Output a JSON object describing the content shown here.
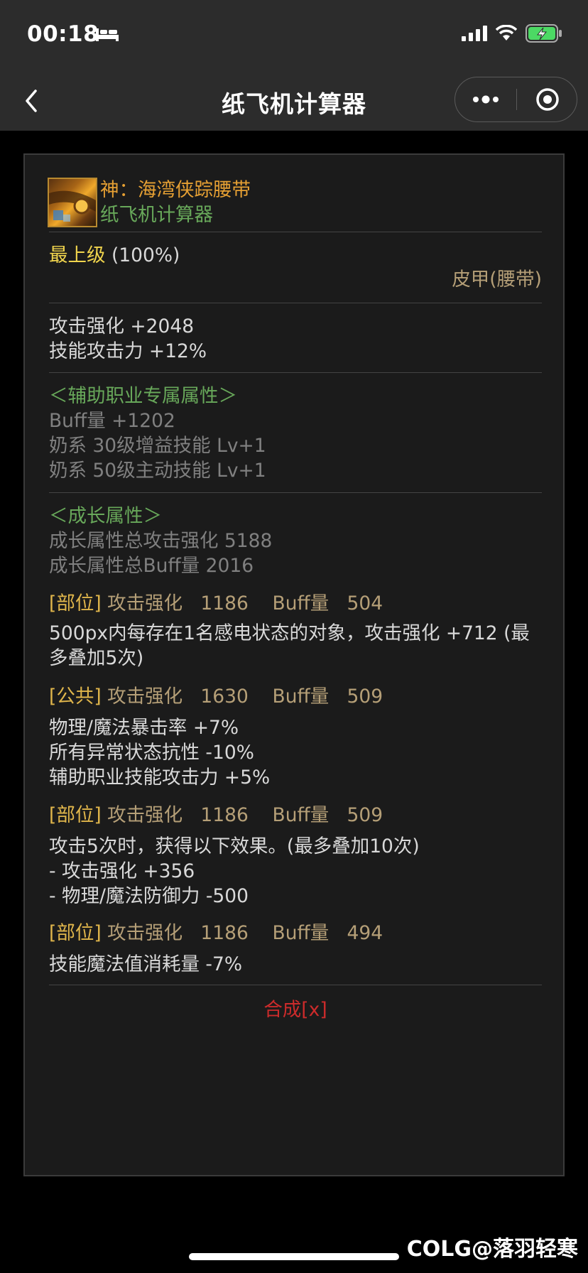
{
  "status": {
    "time": "00:18"
  },
  "nav": {
    "title": "纸飞机计算器"
  },
  "item": {
    "name": "神：海湾侠踪腰带",
    "source": "纸飞机计算器",
    "grade_label": "最上级",
    "grade_value": "(100%)",
    "type": "皮甲(腰带)",
    "base_stats": [
      "攻击强化 +2048",
      "技能攻击力 +12%"
    ],
    "support_title": "＜辅助职业专属属性＞",
    "support_stats": [
      "Buff量 +1202",
      "奶系 30级增益技能 Lv+1",
      "奶系 50级主动技能 Lv+1"
    ],
    "growth_title": "＜成长属性＞",
    "growth_totals": [
      "成长属性总攻击强化 5188",
      "成长属性总Buff量 2016"
    ],
    "options": [
      {
        "tag": "[部位]",
        "stats": "攻击强化   1186    Buff量   504",
        "effects": [
          "500px内每存在1名感电状态的对象，攻击强化 +712 (最多叠加5次)"
        ]
      },
      {
        "tag": "[公共]",
        "stats": "攻击强化   1630    Buff量   509",
        "effects": [
          "物理/魔法暴击率 +7%",
          "所有异常状态抗性 -10%",
          "辅助职业技能攻击力 +5%"
        ]
      },
      {
        "tag": "[部位]",
        "stats": "攻击强化   1186    Buff量   509",
        "effects": [
          "攻击5次时，获得以下效果。(最多叠加10次)",
          "- 攻击强化 +356",
          "- 物理/魔法防御力 -500"
        ]
      },
      {
        "tag": "[部位]",
        "stats": "攻击强化   1186    Buff量   494",
        "effects": [
          "技能魔法值消耗量 -7%"
        ]
      }
    ],
    "synth": "合成[x]"
  },
  "watermark": "COLG@落羽轻寒"
}
